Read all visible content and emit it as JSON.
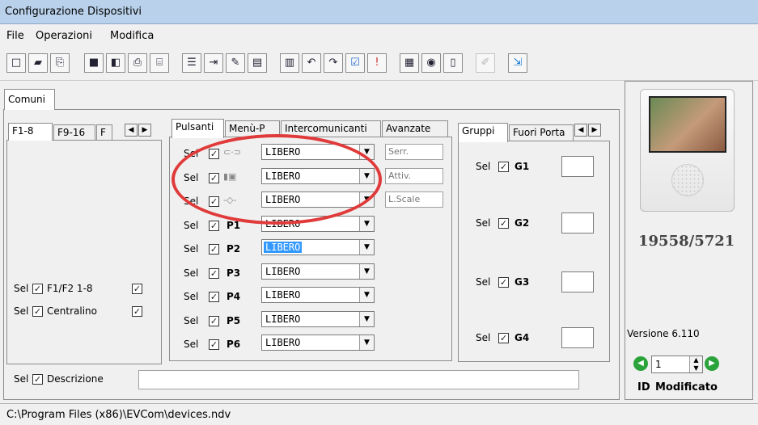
{
  "window": {
    "title": "Configurazione Dispositivi"
  },
  "menu": [
    "File",
    "Operazioni",
    "Modifica"
  ],
  "toolbar_icons": [
    "new-icon",
    "open-icon",
    "import-icon",
    "save-icon",
    "copy-all-icon",
    "print-icon",
    "print-preview-icon",
    "list-icon",
    "export-icon",
    "edit-icon",
    "clipboard-icon",
    "paste-icon",
    "undo-icon",
    "redo-icon",
    "check-icon",
    "alert-icon",
    "table-icon",
    "camera-icon",
    "phone-icon",
    "disabled-tool-icon",
    "exit-icon"
  ],
  "main_tab": {
    "label": "Comuni"
  },
  "left_tabs": [
    "F1-8",
    "F9-16",
    "F"
  ],
  "left_rows": [
    {
      "sel": "Sel",
      "label": "F1/F2 1-8"
    },
    {
      "sel": "Sel",
      "label": "Centralino"
    }
  ],
  "center_tabs": [
    "Pulsanti",
    "Menù-P",
    "Intercomunicanti",
    "Avanzate"
  ],
  "pulsanti": [
    {
      "sel": "Sel",
      "name": "",
      "icon": "lock-icon",
      "value": "LIBERO",
      "side": "Serr.",
      "highlight": false
    },
    {
      "sel": "Sel",
      "name": "",
      "icon": "camera-activate-icon",
      "value": "LIBERO",
      "side": "Attiv.",
      "highlight": false
    },
    {
      "sel": "Sel",
      "name": "",
      "icon": "stair-light-icon",
      "value": "LIBERO",
      "side": "L.Scale",
      "highlight": false
    },
    {
      "sel": "Sel",
      "name": "P1",
      "value": "LIBERO",
      "highlight": false
    },
    {
      "sel": "Sel",
      "name": "P2",
      "value": "LIBERO",
      "highlight": true
    },
    {
      "sel": "Sel",
      "name": "P3",
      "value": "LIBERO",
      "highlight": false
    },
    {
      "sel": "Sel",
      "name": "P4",
      "value": "LIBERO",
      "highlight": false
    },
    {
      "sel": "Sel",
      "name": "P5",
      "value": "LIBERO",
      "highlight": false
    },
    {
      "sel": "Sel",
      "name": "P6",
      "value": "LIBERO",
      "highlight": false
    }
  ],
  "right_tabs": [
    "Gruppi",
    "Fuori Porta"
  ],
  "gruppi": [
    {
      "sel": "Sel",
      "name": "G1",
      "value": ""
    },
    {
      "sel": "Sel",
      "name": "G2",
      "value": ""
    },
    {
      "sel": "Sel",
      "name": "G3",
      "value": ""
    },
    {
      "sel": "Sel",
      "name": "G4",
      "value": ""
    }
  ],
  "descrizione": {
    "sel": "Sel",
    "label": "Descrizione",
    "value": ""
  },
  "device": {
    "model": "19558/5721",
    "version": "Versione 6.110",
    "id_value": "1",
    "id_label": "ID",
    "modified_label": "Modificato"
  },
  "status": {
    "path": "C:\\Program Files (x86)\\EVCom\\devices.ndv"
  },
  "colors": {
    "titlebar": "#b9d1ea",
    "highlight": "#3399ff",
    "annotation": "#e03a3a",
    "nav_green": "#2aa33a"
  }
}
